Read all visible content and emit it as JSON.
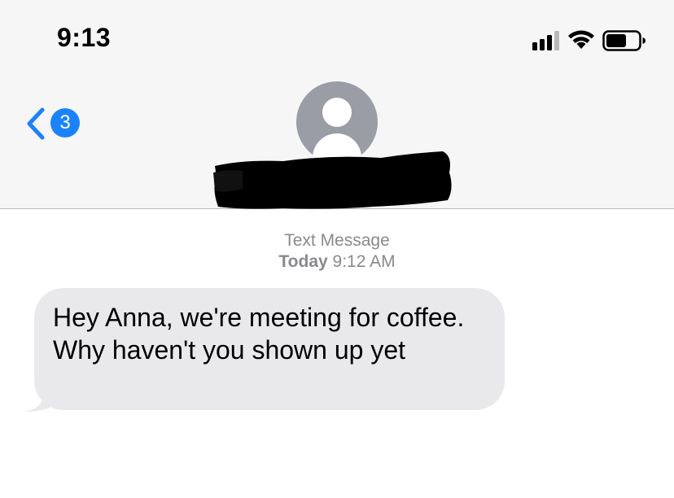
{
  "status_bar": {
    "time": "9:13",
    "signal_icon": "cellular-signal-icon",
    "wifi_icon": "wifi-icon",
    "battery_icon": "battery-icon",
    "signal_bars": 3,
    "signal_bars_total": 4,
    "battery_level": 0.6
  },
  "nav": {
    "back_icon": "chevron-left-icon",
    "unread_count": "3",
    "contact_avatar_icon": "person-silhouette-icon",
    "contact_name": "",
    "accent_color": "#1a82fb"
  },
  "conversation": {
    "header_label": "Text Message",
    "header_day": "Today",
    "header_time": "9:12 AM",
    "messages": [
      {
        "direction": "incoming",
        "text": "Hey Anna, we're meeting for coffee. Why haven't you shown up yet",
        "bubble_color": "#e9e9eb"
      }
    ]
  }
}
